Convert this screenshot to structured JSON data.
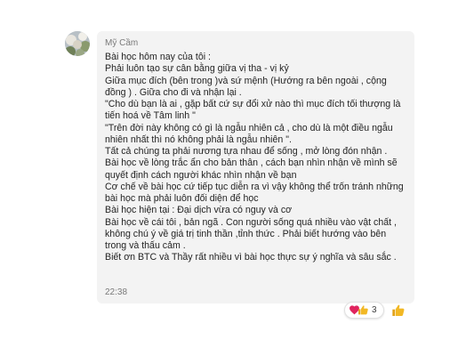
{
  "message": {
    "sender": "Mỹ Cầm",
    "timestamp": "22:38",
    "lines": [
      "Bài học hôm nay của tôi :",
      "Phải luôn tạo sự cân bằng giữa vị tha - vị kỷ",
      "Giữa mục đích (bên trong )và sứ mệnh (Hướng ra bên ngoài , cộng",
      "đồng ) . Giữa cho đi và nhận lại .",
      "\"Cho dù bạn là ai , gặp bất cứ sự đổi xử nào thì mục đích tối thượng là",
      "tiến hoá về Tâm linh \"",
      "\"Trên đời này không có gì là ngẫu nhiên cả , cho dù là một điều ngẫu",
      "nhiên nhất thì nó không phải là ngẫu nhiên \".",
      "Tất cả chúng ta phải nương tựa nhau để sống , mở lòng đón nhận .",
      "Bài học về lòng trắc ẩn cho bản thân , cách bạn nhìn nhận về mình sẽ",
      "quyết định cách người khác nhìn nhận về bạn",
      "Cơ chế về bài học cứ tiếp tục diễn ra vì vậy không thể trốn tránh những",
      "bài học mà phải luôn đối diện để học",
      "Bài học hiện tại : Đại dịch vừa có nguy và cơ",
      "Bài học về cái tôi , bản ngã . Con người sống quá nhiều vào vật chất ,",
      "không chú ý về giá trị tinh thần ,tỉnh thức . Phải biết hướng vào bên",
      "trong và thấu cảm .",
      "Biết ơn BTC và Thầy rất nhiều vì bài học thực sự ý nghĩa và sâu sắc ."
    ]
  },
  "reactions": {
    "icons": [
      "heart-icon",
      "thumbs-up-icon"
    ],
    "count": "3"
  },
  "colors": {
    "bubble": "#f3f3f3",
    "text": "#242424",
    "meta": "#7a7a7a",
    "heart": "#e0245e",
    "thumb": "#f2b824"
  }
}
